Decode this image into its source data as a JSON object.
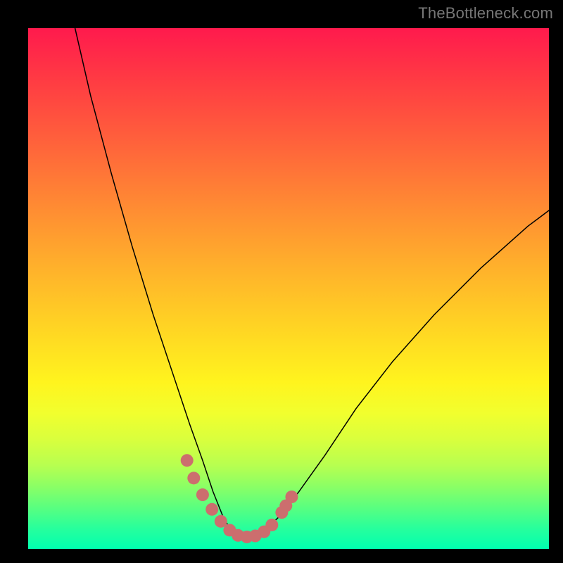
{
  "watermark": "TheBottleneck.com",
  "chart_data": {
    "type": "line",
    "title": "",
    "xlabel": "",
    "ylabel": "",
    "xlim": [
      0,
      100
    ],
    "ylim": [
      0,
      100
    ],
    "grid": false,
    "legend": false,
    "background_gradient": {
      "top_color": "#ff1a4d",
      "bottom_color": "#00ffb0",
      "note": "vertical red→orange→yellow→green gradient; green band only at very bottom"
    },
    "series": [
      {
        "name": "bottleneck-curve",
        "color": "#000000",
        "stroke_width": 1.5,
        "x": [
          9,
          12,
          16,
          20,
          24,
          28,
          31,
          33.5,
          35.5,
          37.5,
          39.3,
          40.5,
          43,
          45,
          48,
          52,
          57,
          63,
          70,
          78,
          87,
          96,
          100
        ],
        "y": [
          100,
          87,
          72,
          58,
          45,
          33,
          24,
          17,
          11,
          6,
          3,
          2.3,
          2.3,
          3.2,
          6,
          11,
          18,
          27,
          36,
          45,
          54,
          62,
          65
        ]
      },
      {
        "name": "highlight-dots",
        "color": "#cc6e6e",
        "type": "scatter",
        "marker_radius": 9,
        "x": [
          30.5,
          31.8,
          33.5,
          35.3,
          37.0,
          38.7,
          40.3,
          42.0,
          43.6,
          45.3,
          46.8,
          48.7,
          49.5,
          50.6
        ],
        "y": [
          17.0,
          13.6,
          10.4,
          7.6,
          5.3,
          3.6,
          2.6,
          2.3,
          2.5,
          3.3,
          4.6,
          7.0,
          8.3,
          10.0
        ]
      }
    ]
  }
}
